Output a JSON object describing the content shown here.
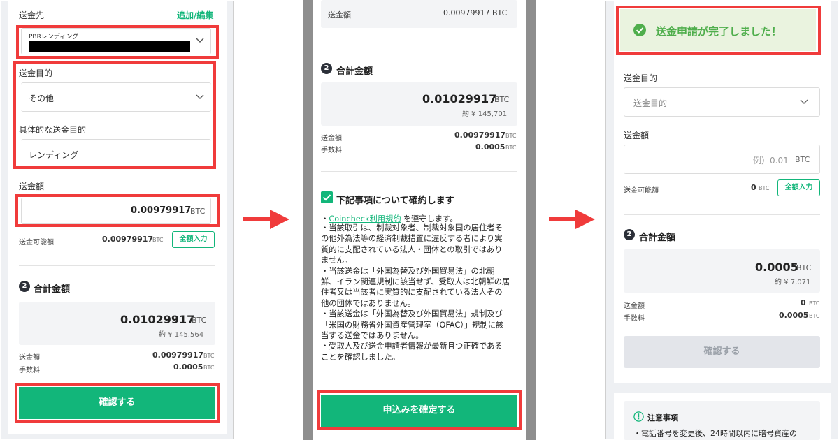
{
  "panel1": {
    "recipient_label": "送金先",
    "add_edit_link": "追加/編集",
    "recipient_name": "PBRレンディング",
    "purpose_label": "送金目的",
    "purpose_value": "その他",
    "specific_purpose_label": "具体的な送金目的",
    "specific_purpose_value": "レンディング",
    "amount_label": "送金額",
    "amount_value": "0.00979917",
    "amount_unit": "BTC",
    "available_label": "送金可能額",
    "available_value": "0.00979917",
    "available_unit": "BTC",
    "fill_all_button": "全額入力",
    "step_number": "2",
    "total_heading": "合計金額",
    "total_value": "0.01029917",
    "total_unit": "BTC",
    "total_jpy": "約 ¥ 145,564",
    "send_amount_label": "送金額",
    "send_amount_value": "0.00979917",
    "send_amount_unit": "BTC",
    "fee_label": "手数料",
    "fee_value": "0.0005",
    "fee_unit": "BTC",
    "confirm_button": "確認する"
  },
  "panel2": {
    "top_send_label": "送金額",
    "top_send_value": "0.00979917 BTC",
    "step_number": "2",
    "total_heading": "合計金額",
    "total_value": "0.01029917",
    "total_unit": "BTC",
    "total_jpy": "約 ¥ 145,701",
    "send_amount_label": "送金額",
    "send_amount_value": "0.00979917",
    "send_amount_unit": "BTC",
    "fee_label": "手数料",
    "fee_value": "0.0005",
    "fee_unit": "BTC",
    "agree_heading": "下記事項について確約します",
    "terms_bullet": "・",
    "terms_link": "Coincheck利用規約",
    "terms_suffix": "を遵守します。",
    "notice_lines": [
      "・当該取引は、制裁対象者、制裁対象国の居住者そ",
      "の他外為法等の経済制裁措置に違反する者により実",
      "質的に支配されている法人・団体との取引ではあり",
      "ません。",
      "・当該送金は「外国為替及び外国貿易法」の北朝",
      "鮮、イラン関連規制に該当せず、受取人は北朝鮮の居",
      "住者又は当該者に実質的に支配されている法人その",
      "他の団体ではありません。",
      "・当該送金は「外国為替及び外国貿易法」規制及び",
      "「米国の財務省外国資産管理室（OFAC）」規制に該",
      "当する送金ではありません。",
      "・受取人及び送金申請者情報が最新且つ正確である",
      "ことを確認しました。"
    ],
    "submit_button": "申込みを確定する"
  },
  "panel3": {
    "success_message": "送金申請が完了しました！",
    "purpose_label": "送金目的",
    "purpose_placeholder": "送金目的",
    "amount_label": "送金額",
    "amount_placeholder": "例）0.01",
    "amount_unit": "BTC",
    "available_label": "送金可能額",
    "available_value": "0",
    "available_unit": "BTC",
    "fill_all_button": "全額入力",
    "step_number": "2",
    "total_heading": "合計金額",
    "total_value": "0.0005",
    "total_unit": "BTC",
    "total_jpy": "約 ¥ 7,071",
    "send_amount_label": "送金額",
    "send_amount_value": "0",
    "send_amount_unit": "BTC",
    "fee_label": "手数料",
    "fee_value": "0.0005",
    "fee_unit": "BTC",
    "confirm_button": "確認する",
    "notes_title": "注意事項",
    "notes_line": "・電話番号を変更後、24時間以内に暗号資産の"
  },
  "colors": {
    "accent_green": "#12b67a",
    "highlight_red": "#f03b3b",
    "success_bg": "#eaf3df",
    "disabled_btn": "#e3e5ea"
  },
  "icons": [
    "chevron-down-icon",
    "check-circle-icon",
    "checkbox-checked-icon",
    "arrow-right-icon",
    "info-icon"
  ]
}
